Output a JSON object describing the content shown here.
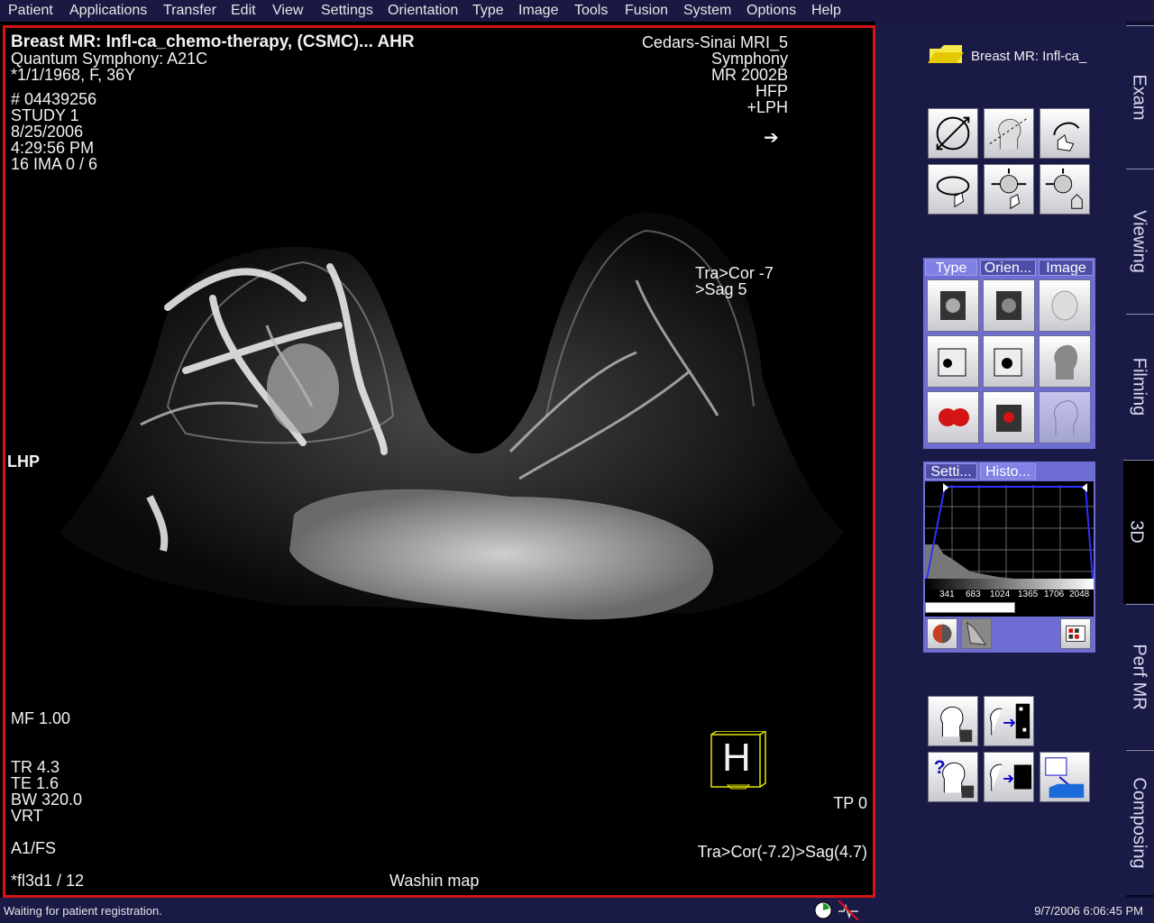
{
  "menu": [
    "Patient",
    "Applications",
    "Transfer",
    "Edit",
    "View",
    "Settings",
    "Orientation",
    "Type",
    "Image",
    "Tools",
    "Fusion",
    "System",
    "Options",
    "Help"
  ],
  "overlay": {
    "title": "Breast MR: Infl-ca_chemo-therapy, (CSMC)... AHR",
    "device": "Quantum Symphony: A21C",
    "patient": "*1/1/1968, F, 36Y",
    "id": "# 04439256",
    "study": "STUDY 1",
    "date": "8/25/2006",
    "time": "4:29:56 PM",
    "ima": "16 IMA 0 / 6",
    "institution": "Cedars-Sinai MRI_5",
    "system": "Symphony",
    "model": "MR 2002B",
    "position": "HFP",
    "orientation": "+LPH",
    "arrow": "➔",
    "view1": "Tra>Cor  -7",
    "view2": ">Sag   5",
    "side": "LHP",
    "mf": "MF 1.00",
    "tr": "TR 4.3",
    "te": "TE 1.6",
    "bw": "BW 320.0",
    "mode": "VRT",
    "coil": "A1/FS",
    "seq": "*fl3d1 / 12",
    "map": "Washin map",
    "tp": "TP 0",
    "viewfull": "Tra>Cor(-7.2)>Sag(4.7)",
    "cube_letter": "H"
  },
  "side_panel": {
    "folder_label": "Breast MR: Infl-ca_",
    "type_tabs": [
      "Type",
      "Orien...",
      "Image"
    ],
    "histo_tabs": [
      "Setti...",
      "Histo..."
    ],
    "histo_ticks": [
      "341",
      "683",
      "1024",
      "1365",
      "1706",
      "2048"
    ],
    "colors": {
      "panel": "#6d6dd3",
      "accent": "#d41414"
    }
  },
  "vtabs": [
    "Exam",
    "Viewing",
    "Filming",
    "3D",
    "Perf MR",
    "Composing"
  ],
  "status": {
    "message": "Waiting for patient registration.",
    "datetime": "9/7/2006 6:06:45 PM"
  }
}
